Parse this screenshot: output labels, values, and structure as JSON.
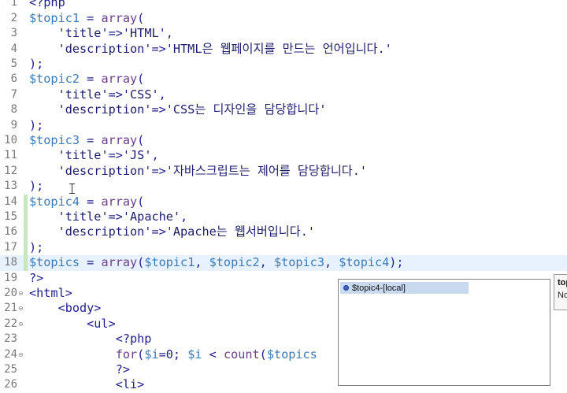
{
  "editor": {
    "current_line": 18,
    "lines": [
      {
        "num": "1",
        "fold": "",
        "changed": false,
        "text": "<?php"
      },
      {
        "num": "2",
        "fold": "",
        "changed": false,
        "text": "$topic1 = array("
      },
      {
        "num": "3",
        "fold": "",
        "changed": false,
        "text": "    'title'=>'HTML',"
      },
      {
        "num": "4",
        "fold": "",
        "changed": false,
        "text": "    'description'=>'HTML은 웹페이지를 만드는 언어입니다.'"
      },
      {
        "num": "5",
        "fold": "",
        "changed": false,
        "text": ");"
      },
      {
        "num": "6",
        "fold": "",
        "changed": false,
        "text": "$topic2 = array("
      },
      {
        "num": "7",
        "fold": "",
        "changed": false,
        "text": "    'title'=>'CSS',"
      },
      {
        "num": "8",
        "fold": "",
        "changed": false,
        "text": "    'description'=>'CSS는 디자인을 담당합니다'"
      },
      {
        "num": "9",
        "fold": "",
        "changed": false,
        "text": ");"
      },
      {
        "num": "10",
        "fold": "",
        "changed": false,
        "text": "$topic3 = array("
      },
      {
        "num": "11",
        "fold": "",
        "changed": false,
        "text": "    'title'=>'JS',"
      },
      {
        "num": "12",
        "fold": "",
        "changed": false,
        "text": "    'description'=>'자바스크립트는 제어를 담당합니다.'"
      },
      {
        "num": "13",
        "fold": "",
        "changed": false,
        "text": ");"
      },
      {
        "num": "14",
        "fold": "",
        "changed": true,
        "text": "$topic4 = array("
      },
      {
        "num": "15",
        "fold": "",
        "changed": true,
        "text": "    'title'=>'Apache',"
      },
      {
        "num": "16",
        "fold": "",
        "changed": true,
        "text": "    'description'=>'Apache는 웹서버입니다.'"
      },
      {
        "num": "17",
        "fold": "",
        "changed": true,
        "text": ");"
      },
      {
        "num": "18",
        "fold": "",
        "changed": true,
        "text": "$topics = array($topic1, $topic2, $topic3, $topic4);"
      },
      {
        "num": "19",
        "fold": "",
        "changed": false,
        "text": "?>"
      },
      {
        "num": "20",
        "fold": "⊖",
        "changed": false,
        "text": "<html>"
      },
      {
        "num": "21",
        "fold": "⊖",
        "changed": false,
        "text": "    <body>"
      },
      {
        "num": "22",
        "fold": "⊖",
        "changed": false,
        "text": "        <ul>"
      },
      {
        "num": "23",
        "fold": "",
        "changed": false,
        "text": "            <?php"
      },
      {
        "num": "24",
        "fold": "⊖",
        "changed": false,
        "text": "            for($i=0; $i < count($topics"
      },
      {
        "num": "25",
        "fold": "",
        "changed": false,
        "text": "            ?>"
      },
      {
        "num": "26",
        "fold": "",
        "changed": false,
        "text": "            <li>"
      }
    ]
  },
  "content_assist": {
    "item_label": "$topic4-[local]",
    "item_icon": "local-variable-icon"
  },
  "info_popup": {
    "line1": "top",
    "line2": "No"
  },
  "colors": {
    "current_line_bg": "#e8f2fe",
    "change_marker": "#c8e6c0",
    "variable": "#3a7ab8",
    "keyword": "#6b3d8a"
  }
}
